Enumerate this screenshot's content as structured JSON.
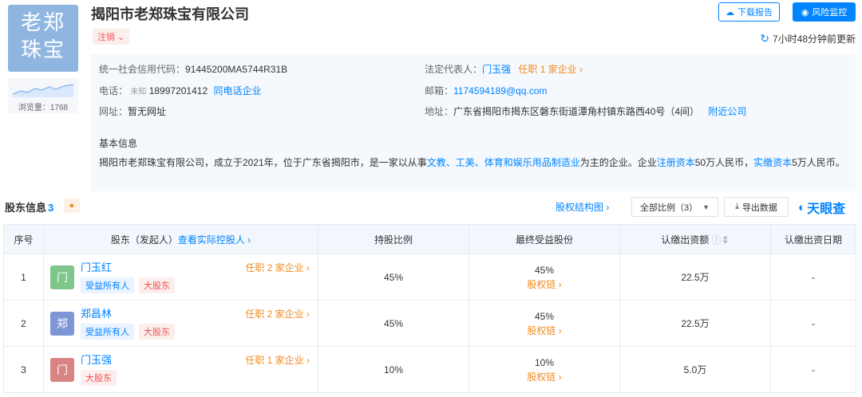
{
  "company": {
    "logo_line1": "老郑",
    "logo_line2": "珠宝",
    "name": "揭阳市老郑珠宝有限公司",
    "status": "注销",
    "views_label": "浏览量：1768"
  },
  "actions": {
    "download_report": "下载报告",
    "risk_monitor": "风险监控",
    "update_time": "7小时48分钟前更新"
  },
  "info": {
    "credit_code_label": "统一社会信用代码：",
    "credit_code": "91445200MA5744R31B",
    "legal_rep_label": "法定代表人：",
    "legal_rep": "门玉强",
    "legal_rep_positions": "任职 1 家企业",
    "phone_label": "电话：",
    "phone_unknown": "未知",
    "phone": "18997201412",
    "same_phone": "同电话企业",
    "email_label": "邮箱：",
    "email": "1174594189@qq.com",
    "website_label": "网址：",
    "website": "暂无网址",
    "address_label": "地址：",
    "address": "广东省揭阳市揭东区磐东街道潭角村镇东路西40号（4间）",
    "nearby": "附近公司",
    "basic_title": "基本信息",
    "basic_p1": "揭阳市老郑珠宝有限公司，成立于2021年，位于广东省揭阳市，是一家以从事",
    "basic_link1": "文教、工美、体育和娱乐用品制造业",
    "basic_p2": "为主的企业。企业",
    "basic_link2": "注册资本",
    "basic_p3": "50万人民币，",
    "basic_link3": "实缴资本",
    "basic_p4": "5万人民币。"
  },
  "shareholders": {
    "title": "股东信息",
    "count": "3",
    "equity_structure": "股权结构图",
    "ratio_select": "全部比例（3）",
    "export": "导出数据",
    "brand": "天眼查",
    "columns": {
      "index": "序号",
      "holder": "股东（发起人）",
      "holder_link": "查看实际控股人",
      "ratio": "持股比例",
      "final": "最终受益股份",
      "capital": "认缴出资额",
      "date": "认缴出资日期"
    },
    "rows": [
      {
        "index": "1",
        "avatar": "门",
        "avatar_color": "#7fc68a",
        "name": "门玉红",
        "positions": "任职 2 家企业",
        "tag1": "受益所有人",
        "tag2": "大股东",
        "ratio": "45%",
        "final": "45%",
        "chain": "股权链",
        "capital": "22.5万",
        "date": "-"
      },
      {
        "index": "2",
        "avatar": "郑",
        "avatar_color": "#7f96d6",
        "name": "郑昌林",
        "positions": "任职 2 家企业",
        "tag1": "受益所有人",
        "tag2": "大股东",
        "ratio": "45%",
        "final": "45%",
        "chain": "股权链",
        "capital": "22.5万",
        "date": "-"
      },
      {
        "index": "3",
        "avatar": "门",
        "avatar_color": "#d98483",
        "name": "门玉强",
        "positions": "任职 1 家企业",
        "tag1": "大股东",
        "ratio": "10%",
        "final": "10%",
        "chain": "股权链",
        "capital": "5.0万",
        "date": "-"
      }
    ]
  },
  "colors": {
    "accent": "#0084ff",
    "orange": "#f28b21",
    "red": "#ef5252"
  }
}
